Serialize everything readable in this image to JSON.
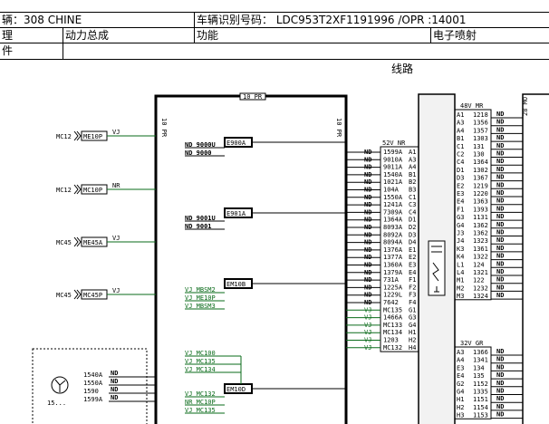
{
  "header": {
    "vehicle": "辆：308 CHINE",
    "vin": "车辆识别号码： LDC953T2XF1191996 /OPR :14001",
    "system_label": "理",
    "assembly": "动力总成",
    "function_label": "功能",
    "function_value": "电子喷射",
    "component_label": "件"
  },
  "diagram": {
    "title": "线路",
    "top_tag": "10 PR",
    "side_tag_left": "10 PR",
    "side_tag_right": "10 PR",
    "right_tag": "28 MO",
    "grounds": [
      {
        "ref": "MC12",
        "conn": "ME10P",
        "wire": "VJ"
      },
      {
        "ref": "MC12",
        "conn": "MC10P",
        "wire": "NR"
      },
      {
        "ref": "MC45",
        "conn": "ME45A",
        "wire": "VJ"
      },
      {
        "ref": "MC45",
        "conn": "MC45P",
        "wire": "VJ"
      }
    ],
    "splices": [
      {
        "name": "E900A",
        "wires": [
          [
            "ND 9000U",
            "black"
          ],
          [
            "ND 9000",
            "black"
          ]
        ]
      },
      {
        "name": "E901A",
        "wires": [
          [
            "ND 9001U",
            "black"
          ],
          [
            "ND 9001",
            "black"
          ]
        ]
      },
      {
        "name": "EM10B",
        "wires": [
          [
            "VJ MBSM2",
            "green"
          ],
          [
            "VJ ME10P",
            "green"
          ],
          [
            "VJ MBSM3",
            "green"
          ]
        ]
      },
      {
        "name": "EM10D",
        "wires": [
          [
            "VJ MC132",
            "green"
          ],
          [
            "NR MC10P",
            "green"
          ],
          [
            "VJ MC135",
            "green"
          ]
        ]
      }
    ],
    "splice_c_wires": [
      "VJ MC100",
      "VJ MC135",
      "VJ MC134"
    ],
    "conn_mid_header": "52V NR",
    "conn_mid": [
      [
        "ND",
        "1599A",
        "A1"
      ],
      [
        "ND",
        "9010A",
        "A3"
      ],
      [
        "ND",
        "9011A",
        "A4"
      ],
      [
        "ND",
        "1540A",
        "B1"
      ],
      [
        "ND",
        "1021A",
        "B2"
      ],
      [
        "ND",
        "104A",
        "B3"
      ],
      [
        "ND",
        "1550A",
        "C1"
      ],
      [
        "ND",
        "1241A",
        "C3"
      ],
      [
        "ND",
        "7309A",
        "C4"
      ],
      [
        "ND",
        "1364A",
        "D1"
      ],
      [
        "ND",
        "8093A",
        "D2"
      ],
      [
        "ND",
        "8092A",
        "D3"
      ],
      [
        "ND",
        "8094A",
        "D4"
      ],
      [
        "ND",
        "1376A",
        "E1"
      ],
      [
        "ND",
        "1377A",
        "E2"
      ],
      [
        "ND",
        "1360A",
        "E3"
      ],
      [
        "ND",
        "1379A",
        "E4"
      ],
      [
        "ND",
        "731A",
        "F1"
      ],
      [
        "ND",
        "1225A",
        "F2"
      ],
      [
        "ND",
        "1229L",
        "F3"
      ],
      [
        "ND",
        "7642",
        "F4"
      ],
      [
        "VJ",
        "MC135",
        "G1"
      ],
      [
        "VJ",
        "1466A",
        "G3"
      ],
      [
        "VJ",
        "MC133",
        "G4"
      ],
      [
        "VJ",
        "MC134",
        "H1"
      ],
      [
        "VJ",
        "1203",
        "H2"
      ],
      [
        "VJ",
        "MC132",
        "H4"
      ]
    ],
    "conn_r1_header": "48V MR",
    "conn_r1": [
      [
        "A1",
        "1218",
        "ND"
      ],
      [
        "A3",
        "1356",
        "ND"
      ],
      [
        "A4",
        "1357",
        "ND"
      ],
      [
        "B1",
        "1303",
        "ND"
      ],
      [
        "C1",
        "131",
        "ND"
      ],
      [
        "C2",
        "130",
        "ND"
      ],
      [
        "C4",
        "1364",
        "ND"
      ],
      [
        "D1",
        "1302",
        "ND"
      ],
      [
        "D3",
        "1367",
        "ND"
      ],
      [
        "E2",
        "1219",
        "ND"
      ],
      [
        "E3",
        "1220",
        "ND"
      ],
      [
        "E4",
        "1363",
        "ND"
      ],
      [
        "F1",
        "1393",
        "ND"
      ],
      [
        "G3",
        "1131",
        "ND"
      ],
      [
        "G4",
        "1362",
        "ND"
      ],
      [
        "J3",
        "1362",
        "ND"
      ],
      [
        "J4",
        "1323",
        "ND"
      ],
      [
        "K3",
        "1361",
        "ND"
      ],
      [
        "K4",
        "1322",
        "ND"
      ],
      [
        "L1",
        "124",
        "ND"
      ],
      [
        "L4",
        "1321",
        "ND"
      ],
      [
        "M1",
        "122",
        "ND"
      ],
      [
        "M2",
        "1232",
        "ND"
      ],
      [
        "M3",
        "1324",
        "ND"
      ]
    ],
    "conn_r2_header": "32V GR",
    "conn_r2": [
      [
        "A3",
        "1366",
        "ND"
      ],
      [
        "A4",
        "1341",
        "ND"
      ],
      [
        "E3",
        "134",
        "ND"
      ],
      [
        "E4",
        "135",
        "ND"
      ],
      [
        "G2",
        "1152",
        "ND"
      ],
      [
        "G4",
        "1335",
        "ND"
      ],
      [
        "H1",
        "1151",
        "ND"
      ],
      [
        "H2",
        "1154",
        "ND"
      ],
      [
        "H3",
        "1153",
        "ND"
      ]
    ],
    "fan_wires": [
      [
        "1540A",
        "ND"
      ],
      [
        "1550A",
        "ND"
      ],
      [
        "1590",
        "ND"
      ],
      [
        "1599A",
        "ND"
      ]
    ],
    "fan_ref": "15..."
  },
  "colors": {
    "wire_green": "#0a6b1a",
    "line": "#000000"
  }
}
